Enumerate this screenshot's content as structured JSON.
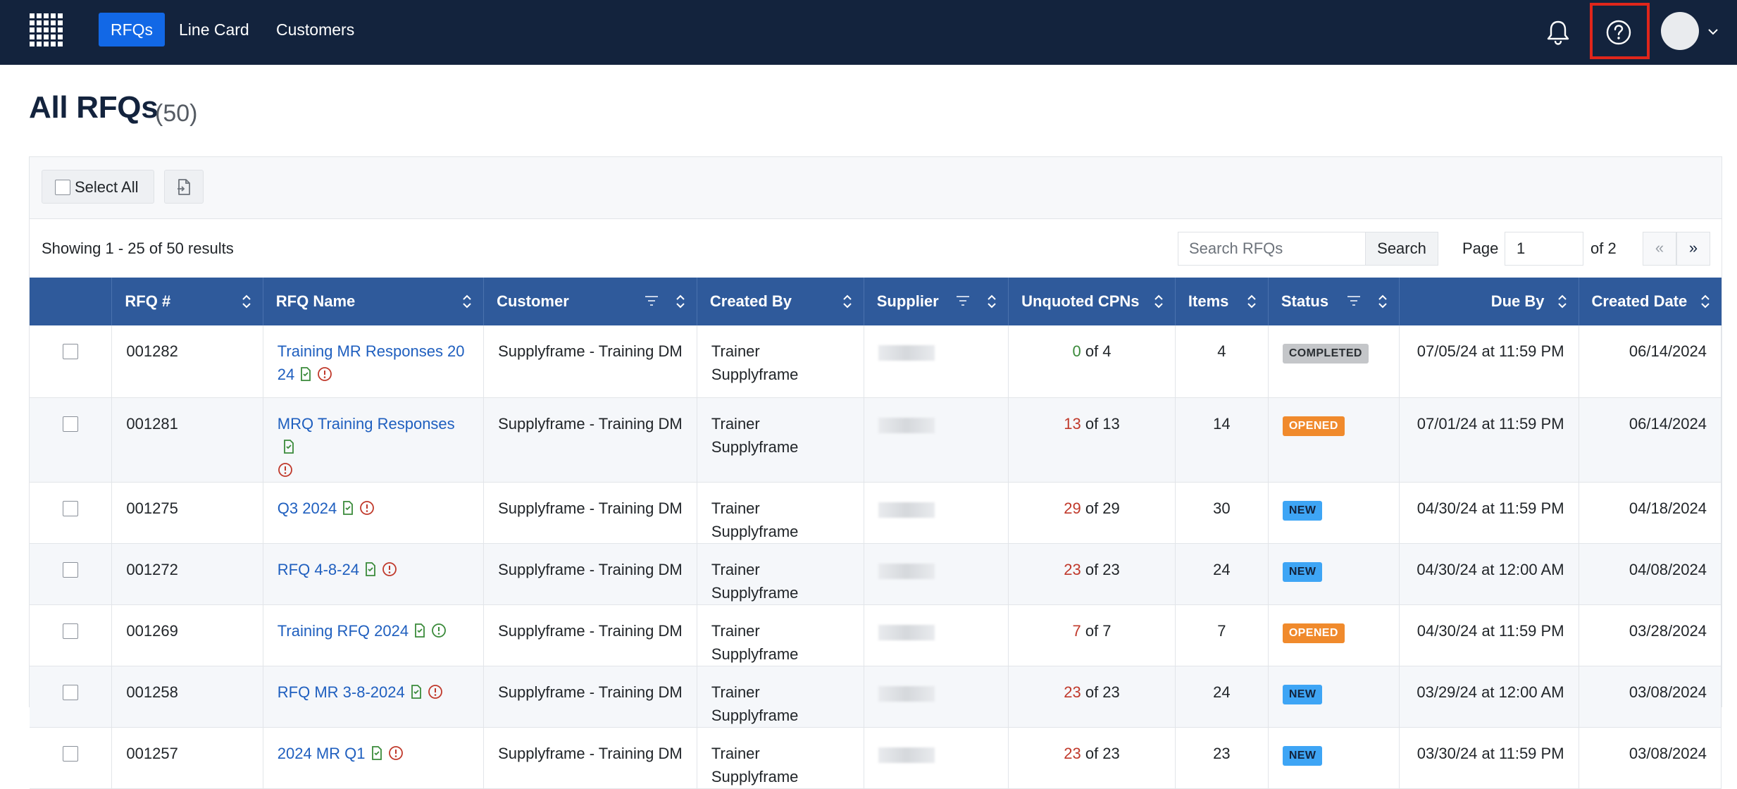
{
  "nav": {
    "items": [
      "RFQs",
      "Line Card",
      "Customers"
    ]
  },
  "page": {
    "title": "All RFQs",
    "count": "(50)"
  },
  "toolbar": {
    "select_all_label": "Select All"
  },
  "results": {
    "text": "Showing 1 - 25 of 50 results"
  },
  "search": {
    "placeholder": "Search RFQs",
    "button_label": "Search"
  },
  "pagination": {
    "page_label": "Page",
    "current_page": "1",
    "of_label": "of 2",
    "prev_label": "«",
    "next_label": "»"
  },
  "table": {
    "columns": [
      "RFQ #",
      "RFQ Name",
      "Customer",
      "Created By",
      "Supplier",
      "Unquoted CPNs",
      "Items",
      "Status",
      "Due By",
      "Created Date"
    ],
    "rows": [
      {
        "rfq": "001282",
        "name": "Training MR Responses 20 24",
        "customer": "Supplyframe - Training DM",
        "created_by": "Trainer Supplyframe",
        "unquoted": "0",
        "unquoted_of": " of 4",
        "items": "4",
        "status": "COMPLETED",
        "due": "07/05/24 at 11:59 PM",
        "created": "06/14/2024"
      },
      {
        "rfq": "001281",
        "name": "MRQ Training Responses",
        "customer": "Supplyframe - Training DM",
        "created_by": "Trainer Supplyframe",
        "unquoted": "13",
        "unquoted_of": " of 13",
        "items": "14",
        "status": "OPENED",
        "due": "07/01/24 at 11:59 PM",
        "created": "06/14/2024"
      },
      {
        "rfq": "001275",
        "name": "Q3 2024",
        "customer": "Supplyframe - Training DM",
        "created_by": "Trainer Supplyframe",
        "unquoted": "29",
        "unquoted_of": " of 29",
        "items": "30",
        "status": "NEW",
        "due": "04/30/24 at 11:59 PM",
        "created": "04/18/2024"
      },
      {
        "rfq": "001272",
        "name": "RFQ 4-8-24",
        "customer": "Supplyframe - Training DM",
        "created_by": "Trainer Supplyframe",
        "unquoted": "23",
        "unquoted_of": " of 23",
        "items": "24",
        "status": "NEW",
        "due": "04/30/24 at 12:00 AM",
        "created": "04/08/2024"
      },
      {
        "rfq": "001269",
        "name": "Training RFQ 2024",
        "customer": "Supplyframe - Training DM",
        "created_by": "Trainer Supplyframe",
        "unquoted": "7",
        "unquoted_of": " of 7",
        "items": "7",
        "status": "OPENED",
        "due": "04/30/24 at 11:59 PM",
        "created": "03/28/2024"
      },
      {
        "rfq": "001258",
        "name": "RFQ MR 3-8-2024",
        "customer": "Supplyframe - Training DM",
        "created_by": "Trainer Supplyframe",
        "unquoted": "23",
        "unquoted_of": " of 23",
        "items": "24",
        "status": "NEW",
        "due": "03/29/24 at 12:00 AM",
        "created": "03/08/2024"
      },
      {
        "rfq": "001257",
        "name": "2024 MR Q1",
        "customer": "Supplyframe - Training DM",
        "created_by": "Trainer Supplyframe",
        "unquoted": "23",
        "unquoted_of": " of 23",
        "items": "23",
        "status": "NEW",
        "due": "03/30/24 at 11:59 PM",
        "created": "03/08/2024"
      }
    ]
  },
  "colors": {
    "nav_bg": "#13233d",
    "nav_active": "#1268e6",
    "table_header": "#2f5a9b",
    "link": "#1f5fbf",
    "due_red": "#bf3b35",
    "highlight_box": "#e0261b",
    "badge_completed": "#c4c6c9",
    "badge_opened": "#f08a2c",
    "badge_new": "#3ea5f5"
  },
  "icons": [
    "grid-logo-icon",
    "bell-icon",
    "help-circle-icon",
    "chevron-down-icon",
    "export-file-icon",
    "sort-icon",
    "filter-icon",
    "document-green-icon",
    "info-circle-icon"
  ]
}
